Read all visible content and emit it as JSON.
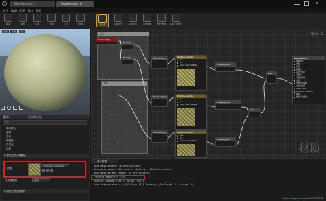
{
  "tabs": [
    {
      "label": "NewMaterial_2"
    },
    {
      "label": "NewMaterial_3*"
    }
  ],
  "menu": [
    "文件",
    "编辑",
    "资源",
    "窗口",
    "帮助"
  ],
  "toolbar": [
    "保存",
    "浏览",
    "应用",
    "搜索",
    "主页",
    "清理",
    "连接器",
    "实时预览",
    "实时节点",
    "实时更新",
    "统计数据",
    "移动平台统计"
  ],
  "graph_label": "细节-2",
  "preview_toolbar": [
    "透视",
    "照明",
    "显示"
  ],
  "details": {
    "tab1": "细节",
    "tab2": "参数默认值",
    "search_placeholder": "搜索",
    "props": [
      "基础颜色",
      "金属",
      "高光",
      "粗糙度",
      "自发光",
      "法线"
    ],
    "section": "材质表达式纹理基础",
    "param_label": "纹理",
    "texture_name": "NewTexture2D9a0e",
    "sampler_label": "采样器类型",
    "sampler_value": "颜色",
    "section2": "材质表达式纹理采样"
  },
  "nodes": {
    "param": "TexCoord[0]",
    "mul1": "Multiply",
    "mul2": "Multiply",
    "tc1": "TexCoord[1]",
    "tc2": "TexCoord[1]",
    "tc3": "TexCoord[1]",
    "ts": "Texture Sample",
    "mul3": "Multiply(0.8)",
    "mul4": "Multiply(0.8)",
    "mul5": "Multiply(0.8)",
    "add1": "Add",
    "add2": "Add",
    "result": "NewMaterial"
  },
  "pins": [
    "UVs",
    "Tex",
    "Apply View MipBias"
  ],
  "outputs": [
    "基础颜色",
    "金属",
    "高光",
    "粗糙度",
    "自发光颜色",
    "不透明",
    "不透明蒙版",
    "法线",
    "世界位置偏移",
    "次表面颜色",
    "Clear Coat",
    "Ambient Occlusion",
    "折射",
    "像素深度偏移"
  ],
  "stats_panel": {
    "title": "统计数据",
    "lines": [
      "Base pass shader: 48 instructions",
      "Base pass shader with static lighting: 114 instructions",
      "Base pass vertex shader: 40 instructions",
      "Texture samplers: 7/16",
      "Texture Lookups (Est.): VS(0), PS(3)",
      "User interpolators: 2/4 Scalars (1/4 Vectors) (TexCoords: 2, Custom: 0)"
    ]
  },
  "comment_labels": [
    "UV",
    "UV"
  ],
  "watermark": "材质",
  "url": "https://blog.csdn.net/u013412391"
}
